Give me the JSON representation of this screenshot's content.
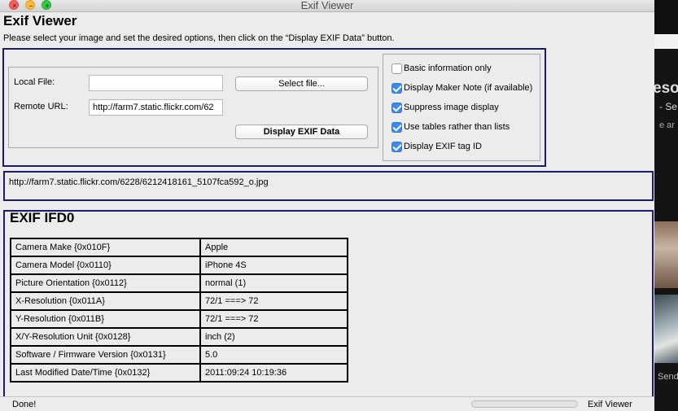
{
  "window": {
    "title": "Exif Viewer"
  },
  "header": {
    "title": "Exif Viewer",
    "instructions": "Please select your image and set the desired options, then click on the “Display EXIF Data” button."
  },
  "source": {
    "local_file_label": "Local File:",
    "local_file_value": "",
    "select_file_label": "Select file...",
    "remote_url_label": "Remote URL:",
    "remote_url_value": "http://farm7.static.flickr.com/62",
    "display_button_label": "Display EXIF Data"
  },
  "options": [
    {
      "label": "Basic information only",
      "checked": false
    },
    {
      "label": "Display Maker Note (if available)",
      "checked": true
    },
    {
      "label": "Suppress image display",
      "checked": true
    },
    {
      "label": "Use tables rather than lists",
      "checked": true
    },
    {
      "label": "Display EXIF tag ID",
      "checked": true
    }
  ],
  "url_display": "http://farm7.static.flickr.com/6228/6212418161_5107fca592_o.jpg",
  "results": {
    "section_title": "EXIF IFD0",
    "rows": [
      {
        "tag": "Camera Make {0x010F}",
        "value": "Apple"
      },
      {
        "tag": "Camera Model {0x0110}",
        "value": "iPhone 4S"
      },
      {
        "tag": "Picture Orientation {0x0112}",
        "value": "normal (1)"
      },
      {
        "tag": "X-Resolution {0x011A}",
        "value": "72/1 ===> 72"
      },
      {
        "tag": "Y-Resolution {0x011B}",
        "value": "72/1 ===> 72"
      },
      {
        "tag": "X/Y-Resolution Unit {0x0128}",
        "value": "inch (2)"
      },
      {
        "tag": "Software / Firmware Version {0x0131}",
        "value": "5.0"
      },
      {
        "tag": "Last Modified Date/Time {0x0132}",
        "value": "2011:09:24 10:19:36"
      }
    ]
  },
  "status": {
    "text": "Done!",
    "progress": 0,
    "app_label": "Exif Viewer"
  },
  "background_app": {
    "fragments": [
      "esol",
      "- Se",
      "e ar",
      "Send"
    ]
  },
  "colors": {
    "panel_border": "#1b1a6e",
    "checkbox_accent": "#3b8bf2",
    "window_bg": "#ececec"
  }
}
